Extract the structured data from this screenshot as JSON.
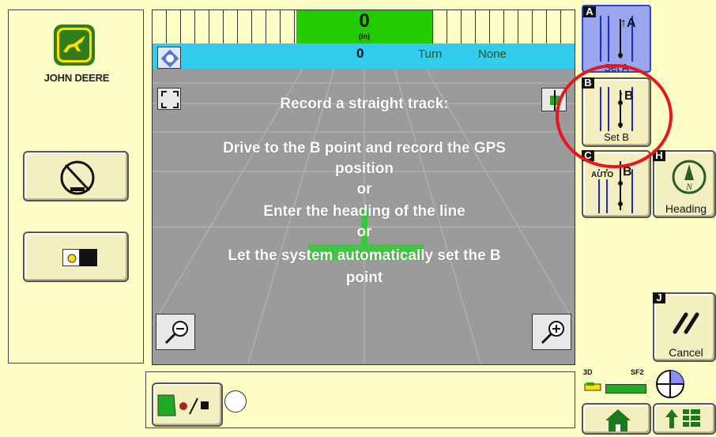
{
  "brand": {
    "name": "John Deere"
  },
  "ruler": {
    "value": "0",
    "unit": "(in)"
  },
  "infobar": {
    "offset": "0",
    "turn_label": "Turn",
    "turn_value": "None"
  },
  "message": {
    "title": "Record a straight track:",
    "line1": "Drive to the B point and record the GPS",
    "line2": "position",
    "or1": "or",
    "line3": "Enter the heading of the line",
    "or2": "or",
    "line4": "Let the system automatically set the B",
    "line5": "point"
  },
  "buttons": {
    "set_a": {
      "letter": "A",
      "label": "Set A"
    },
    "set_b": {
      "letter": "B",
      "label": "Set B"
    },
    "auto_b": {
      "letter": "C",
      "icon_text": "AUTO"
    },
    "heading": {
      "letter": "H",
      "label": "Heading"
    },
    "cancel": {
      "letter": "J",
      "label": "Cancel"
    }
  },
  "status": {
    "mode": "3D",
    "signal": "SF2"
  },
  "colors": {
    "ruler_green": "#22cc00",
    "infobar": "#33ccee",
    "panel": "#fdfdc6",
    "highlight_circle": "#e8141e"
  }
}
